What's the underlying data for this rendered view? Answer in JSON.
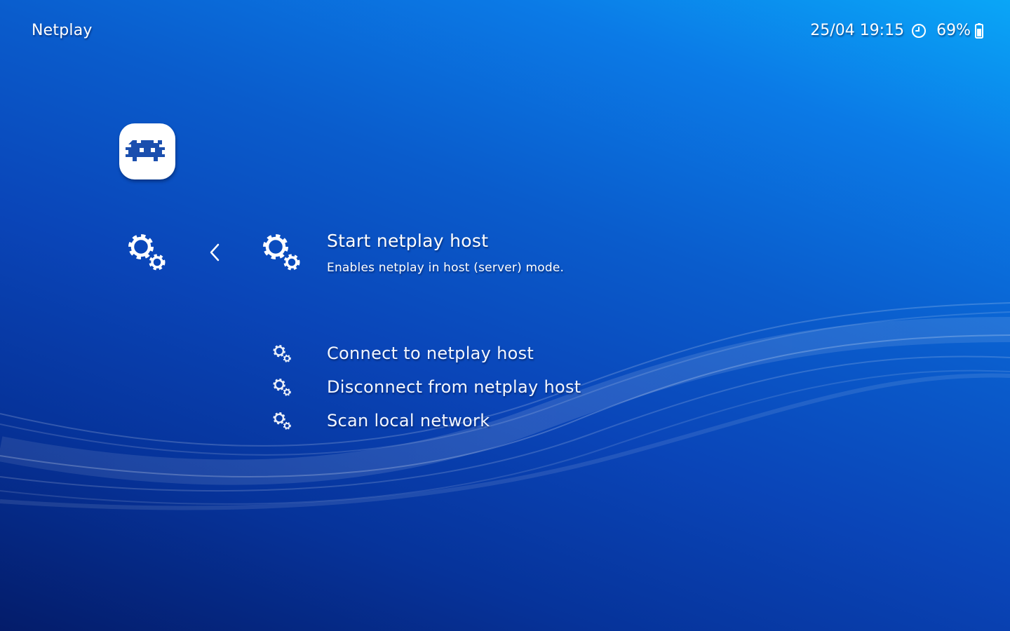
{
  "header": {
    "title": "Netplay"
  },
  "status": {
    "datetime": "25/04 19:15",
    "battery": "69%"
  },
  "icons": {
    "logo": "retroarch-logo-icon",
    "category": "settings-gears-icon",
    "back": "chevron-left-icon",
    "clock": "clock-icon",
    "battery": "battery-icon"
  },
  "menu": {
    "selected": {
      "label": "Start netplay host",
      "sublabel": "Enables netplay in host (server) mode."
    },
    "items": [
      {
        "label": "Connect to netplay host"
      },
      {
        "label": "Disconnect from netplay host"
      },
      {
        "label": "Scan local network"
      }
    ]
  },
  "colors": {
    "background_top": "#0aa6f7",
    "background_bottom": "#041c6a",
    "logo_blue": "#1b4fae",
    "text": "#ffffff"
  }
}
